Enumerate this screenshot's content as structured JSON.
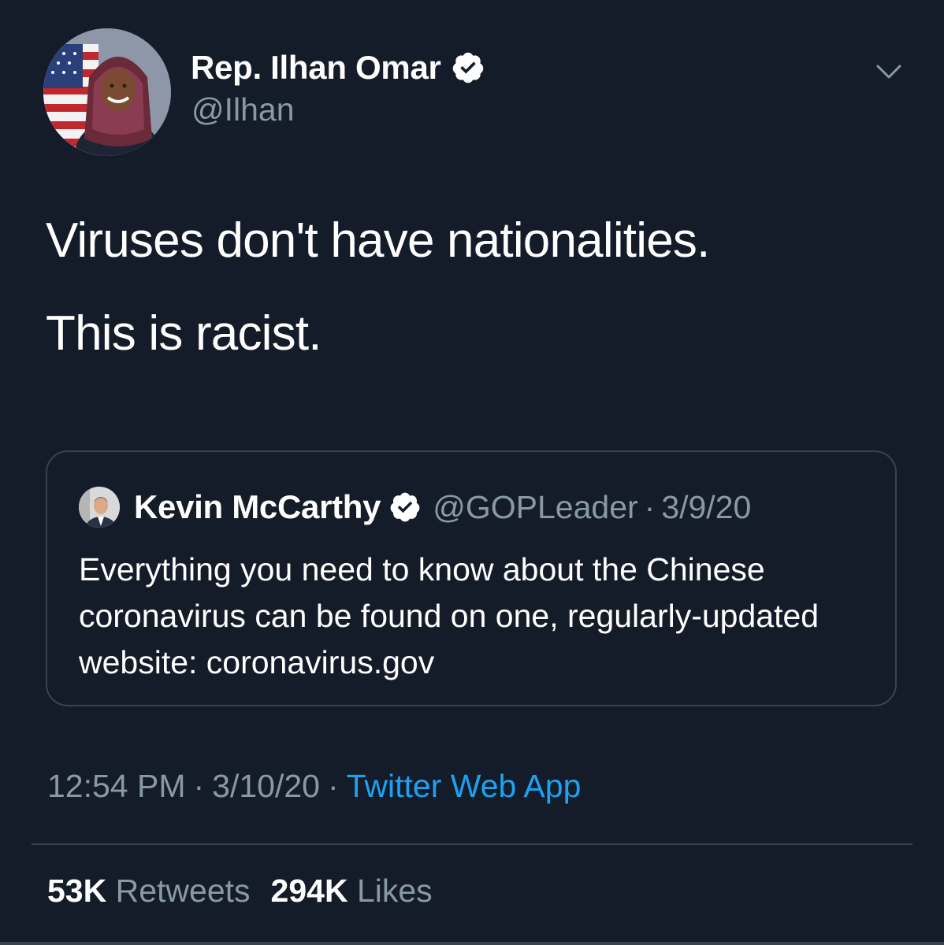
{
  "tweet": {
    "author": {
      "name": "Rep. Ilhan Omar",
      "handle": "@Ilhan",
      "verified": true,
      "avatar_icon": "avatar-photo"
    },
    "menu_icon": "chevron-down-icon",
    "text_lines": [
      "Viruses don't have nationalities.",
      "This is racist."
    ],
    "quoted_tweet": {
      "author_name": "Kevin McCarthy",
      "handle": "@GOPLeader",
      "separator": "·",
      "date": "3/9/20",
      "verified": true,
      "text": "Everything you need to know about the Chinese coronavirus can be found on one, regularly-updated website: coronavirus.gov"
    },
    "meta": {
      "time": "12:54 PM",
      "separator": "·",
      "date": "3/10/20",
      "separator2": "·",
      "source": "Twitter Web App"
    },
    "stats": {
      "retweets_count": "53K",
      "retweets_label": "Retweets",
      "likes_count": "294K",
      "likes_label": "Likes"
    }
  },
  "colors": {
    "background": "#151c29",
    "secondary_text": "#8899a6",
    "link": "#1da1f2",
    "border": "#38444d",
    "verified_badge": "#ffffff"
  }
}
